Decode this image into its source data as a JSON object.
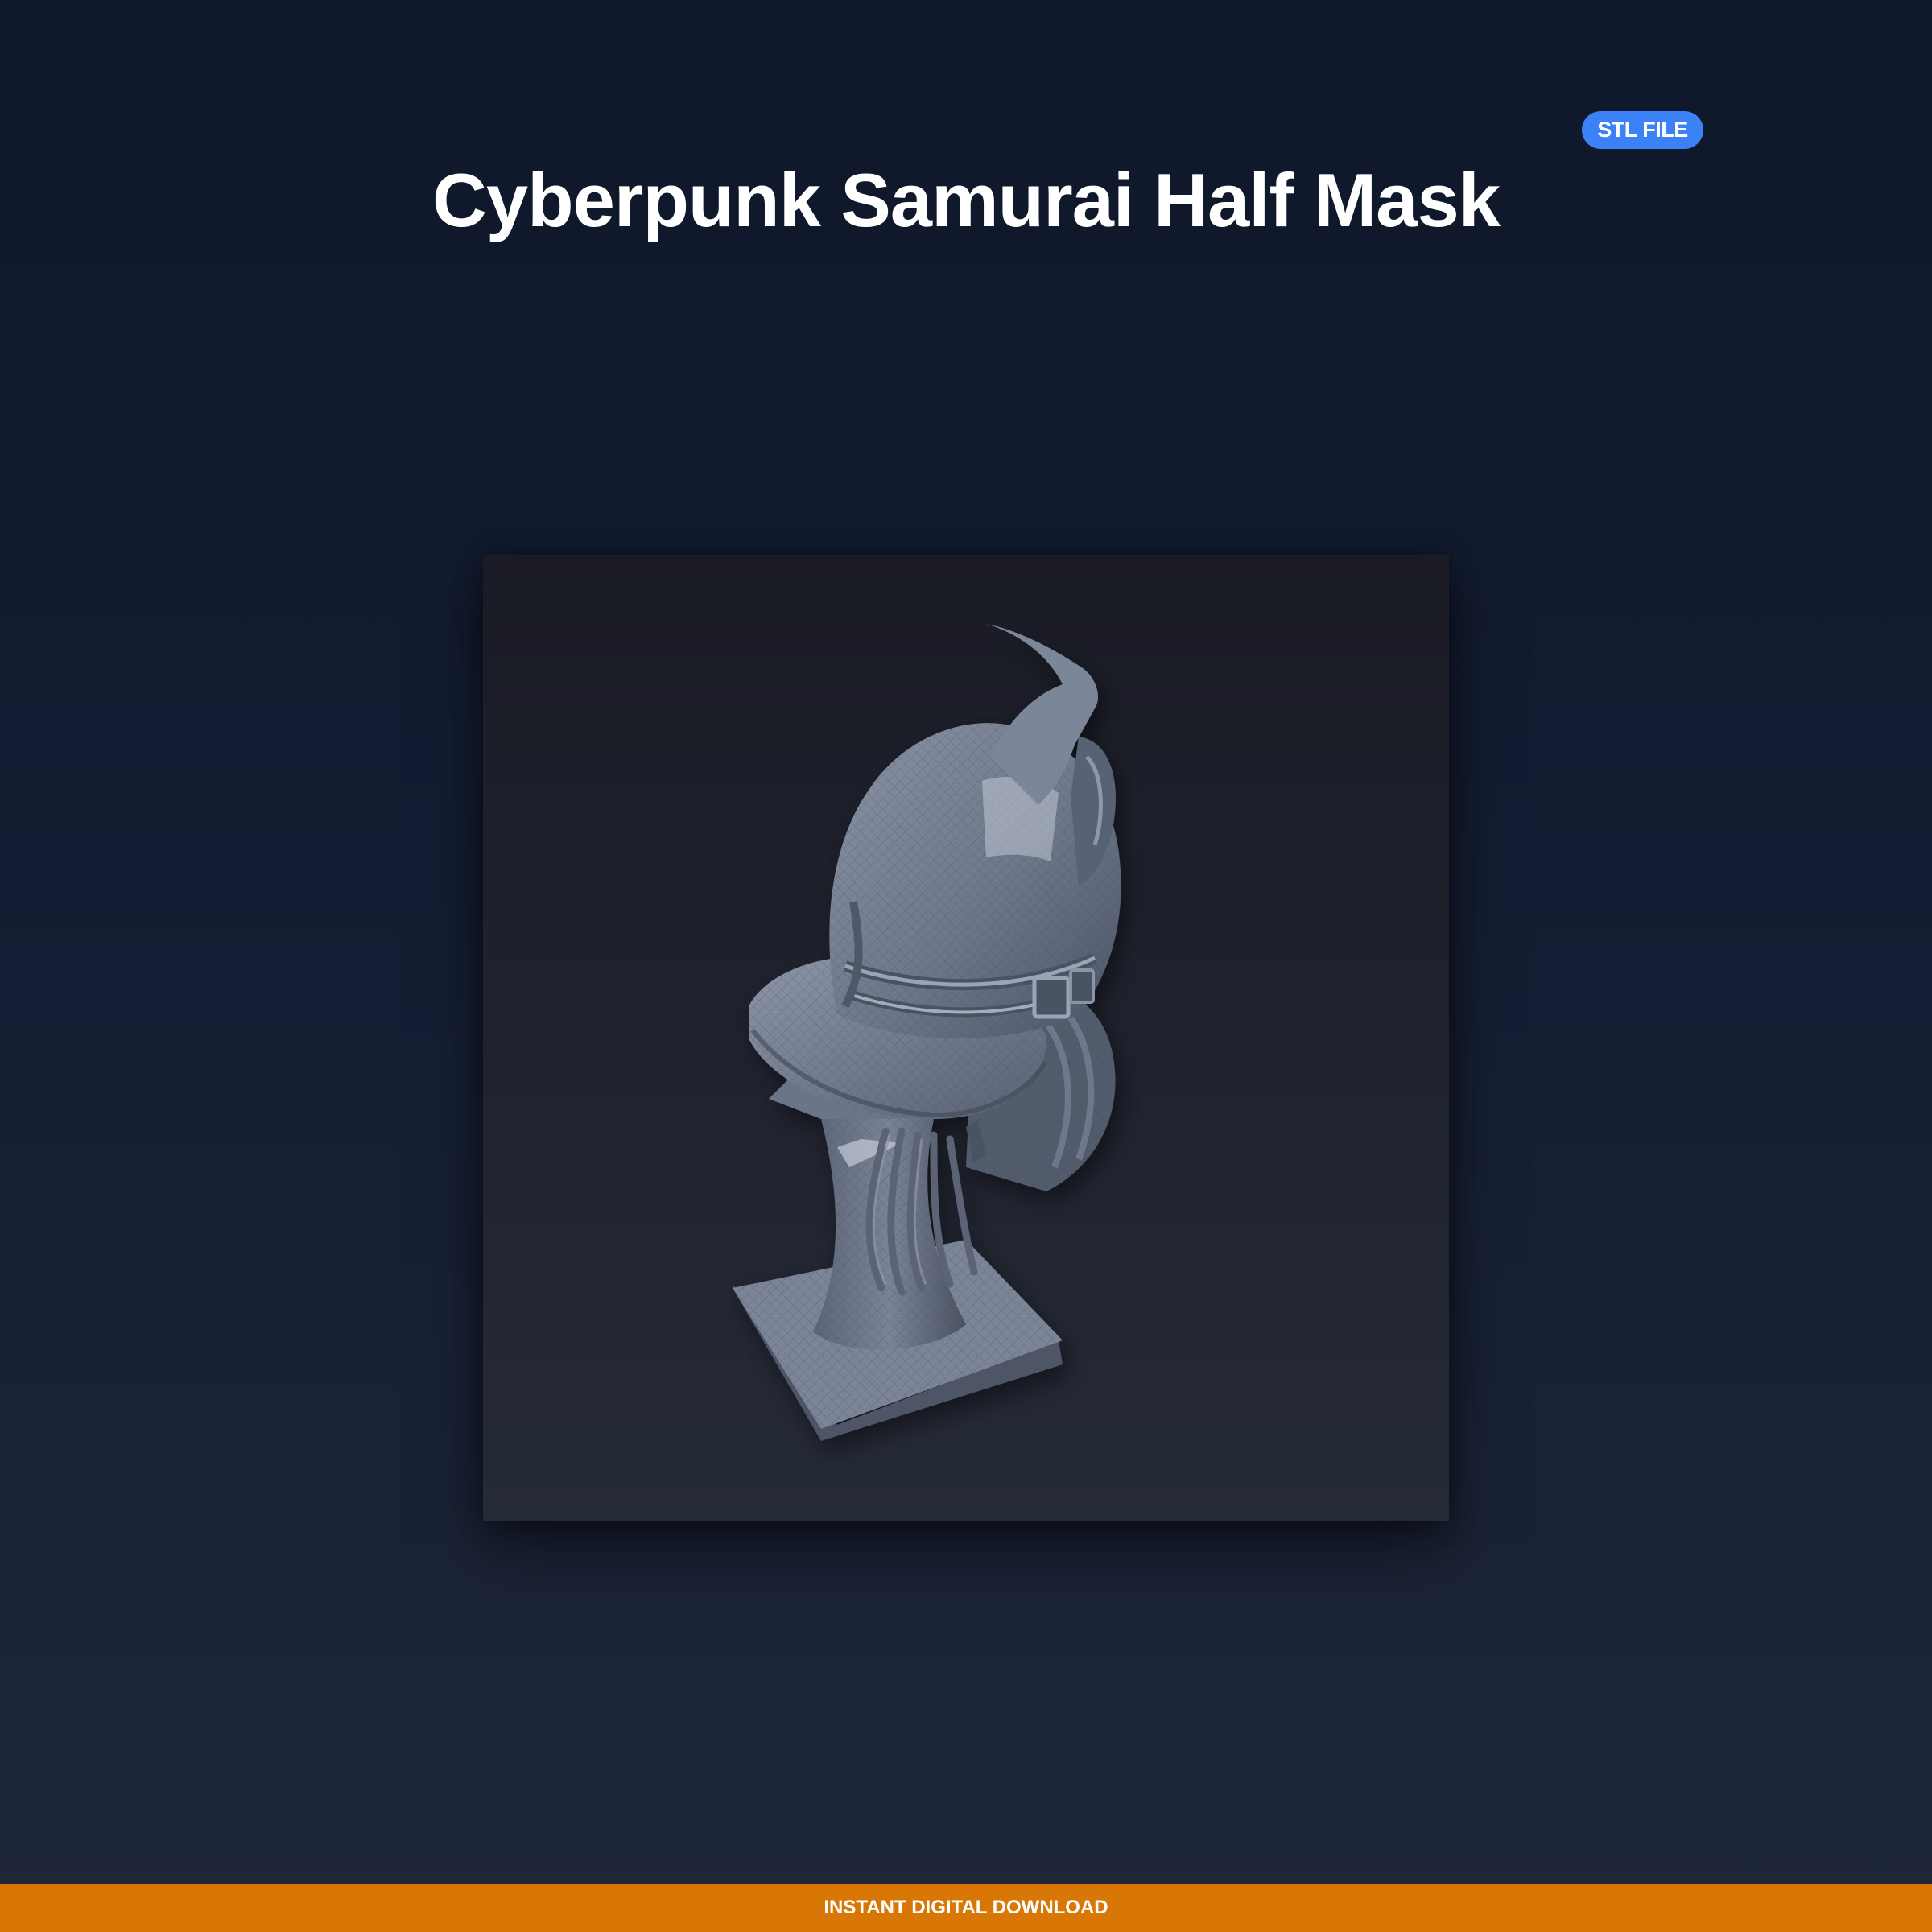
{
  "badge": {
    "label": "STL FILE",
    "color": "#3b82f6"
  },
  "product": {
    "title": "Cyberpunk Samurai Half Mask"
  },
  "preview": {
    "subject_icon": "helmet-render",
    "model_color": "#7c8799"
  },
  "footer": {
    "label": "INSTANT DIGITAL DOWNLOAD",
    "color": "#d97706"
  }
}
